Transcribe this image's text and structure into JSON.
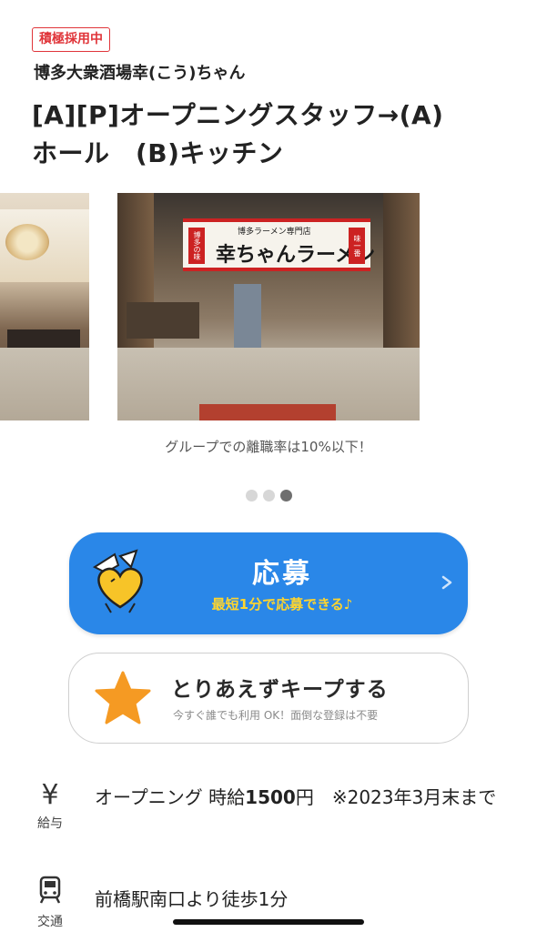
{
  "header": {
    "badge": "積極採用中",
    "company": "博多大衆酒場幸(こう)ちゃん",
    "title_line1": "[A][P]オープニングスタッフ→(A)",
    "title_line2": "ホール　(B)キッチン"
  },
  "carousel": {
    "banner_main": "幸ちゃんラーメン",
    "banner_sub": "博多ラーメン専門店",
    "banner_tag_left": "博多の味",
    "banner_tag_right": "味一番",
    "caption": "グループでの離職率は10%以下！",
    "page_count": 3,
    "active_page": 3
  },
  "apply": {
    "label": "応募",
    "sub": "最短1分で応募できる♪",
    "color": "#2a87e8",
    "sub_color": "#ffd52e",
    "mascot_icon": "heart-mascot-icon",
    "chevron_icon": "chevron-right-icon"
  },
  "keep": {
    "label": "とりあえずキープする",
    "sub": "今すぐ誰でも利用 OK！面倒な登録は不要",
    "star_color": "#f59a23",
    "star_icon": "star-icon"
  },
  "info": {
    "salary": {
      "icon": "yen-icon",
      "icon_glyph": "¥",
      "label": "給与",
      "text_prefix": "オープニング 時給",
      "text_amount": "1500",
      "text_suffix": "円　※2023年3月末まで"
    },
    "access": {
      "icon": "train-icon",
      "label": "交通",
      "text": "前橋駅南口より徒歩1分"
    }
  }
}
